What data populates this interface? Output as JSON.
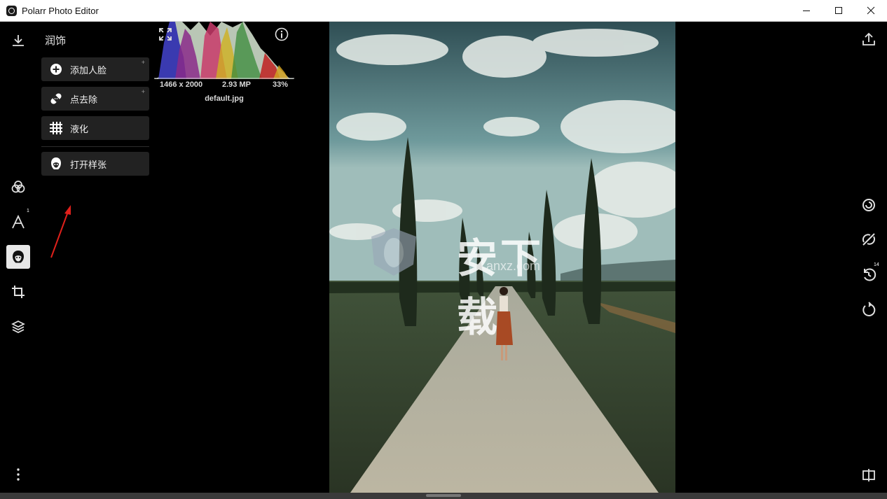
{
  "window": {
    "title": "Polarr Photo Editor",
    "controls": [
      "minimize-icon",
      "maximize-icon",
      "close-icon"
    ]
  },
  "left_rail": {
    "top": {
      "icon": "download-icon"
    },
    "items": [
      {
        "name": "filters",
        "icon": "filters-icon"
      },
      {
        "name": "text",
        "icon": "text-icon",
        "badge": "1"
      },
      {
        "name": "retouch",
        "icon": "face-icon",
        "active": true
      },
      {
        "name": "crop",
        "icon": "crop-icon"
      },
      {
        "name": "layers",
        "icon": "layers-icon"
      }
    ],
    "bottom": {
      "icon": "more-vertical-icon"
    }
  },
  "panel": {
    "title": "润饰",
    "tools": [
      {
        "label": "添加人脸",
        "icon": "add-face-icon",
        "has_plus": true
      },
      {
        "label": "点去除",
        "icon": "bandage-icon",
        "has_plus": true
      },
      {
        "label": "液化",
        "icon": "liquify-grid-icon",
        "has_plus": false
      },
      {
        "label": "打开样张",
        "icon": "face-mask-icon",
        "has_plus": false
      }
    ],
    "plus_mark": "+"
  },
  "histogram": {
    "dimensions": "1466 x 2000",
    "megapixels": "2.93 MP",
    "zoom": "33%",
    "filename": "default.jpg"
  },
  "watermark": {
    "text": "安下载",
    "sub": "anxz.com"
  },
  "right_rail": {
    "items": [
      {
        "icon": "export-icon"
      },
      {
        "icon": "compare-spiral-icon"
      },
      {
        "icon": "slash-disable-icon"
      },
      {
        "icon": "undo-history-icon",
        "badge": "14"
      },
      {
        "icon": "reset-icon"
      },
      {
        "icon": "split-view-icon"
      }
    ]
  },
  "colors": {
    "background": "#000000",
    "button_bg": "#222222",
    "active_rail": "#e8e8e8",
    "arrow_annotation": "#e0201b"
  }
}
